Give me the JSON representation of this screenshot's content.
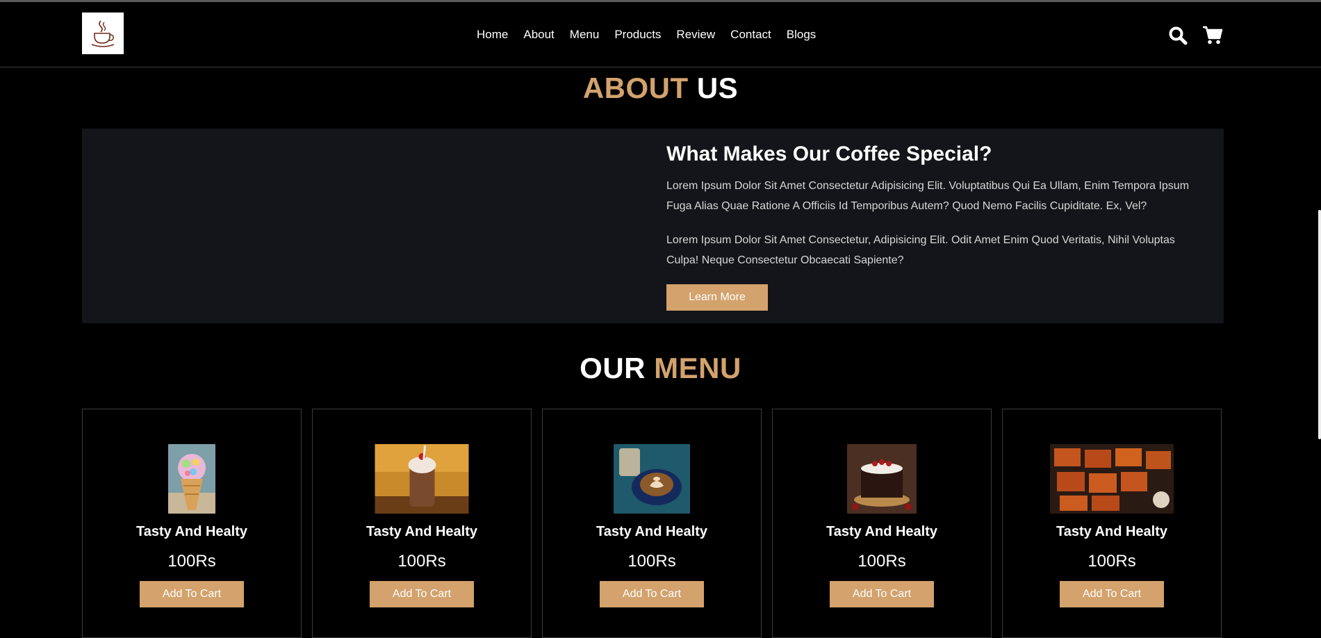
{
  "header": {
    "logo_icon": "coffee-cup-icon",
    "nav": [
      "Home",
      "About",
      "Menu",
      "Products",
      "Review",
      "Contact",
      "Blogs"
    ],
    "icons": [
      "search-icon",
      "cart-icon"
    ]
  },
  "about": {
    "title_accent": "ABOUT",
    "title_rest": "US",
    "heading": "What Makes Our Coffee Special?",
    "para1": "Lorem Ipsum Dolor Sit Amet Consectetur Adipisicing Elit. Voluptatibus Qui Ea Ullam, Enim Tempora Ipsum Fuga Alias Quae Ratione A Officiis Id Temporibus Autem? Quod Nemo Facilis Cupiditate. Ex, Vel?",
    "para2": "Lorem Ipsum Dolor Sit Amet Consectetur, Adipisicing Elit. Odit Amet Enim Quod Veritatis, Nihil Voluptas Culpa! Neque Consectetur Obcaecati Sapiente?",
    "button": "Learn More"
  },
  "menu": {
    "title_first": "OUR",
    "title_accent": "MENU",
    "items": [
      {
        "title": "Tasty And Healty",
        "price": "100Rs",
        "button": "Add To Cart",
        "image": "ice-cream-cone"
      },
      {
        "title": "Tasty And Healty",
        "price": "100Rs",
        "button": "Add To Cart",
        "image": "chocolate-milkshake"
      },
      {
        "title": "Tasty And Healty",
        "price": "100Rs",
        "button": "Add To Cart",
        "image": "coffee-latte-art"
      },
      {
        "title": "Tasty And Healty",
        "price": "100Rs",
        "button": "Add To Cart",
        "image": "black-forest-cake"
      },
      {
        "title": "Tasty And Healty",
        "price": "100Rs",
        "button": "Add To Cart",
        "image": "pan-fried-paneer-tikka"
      }
    ]
  },
  "colors": {
    "accent": "#d3a26d",
    "background": "#000000",
    "panel": "#14151a"
  }
}
